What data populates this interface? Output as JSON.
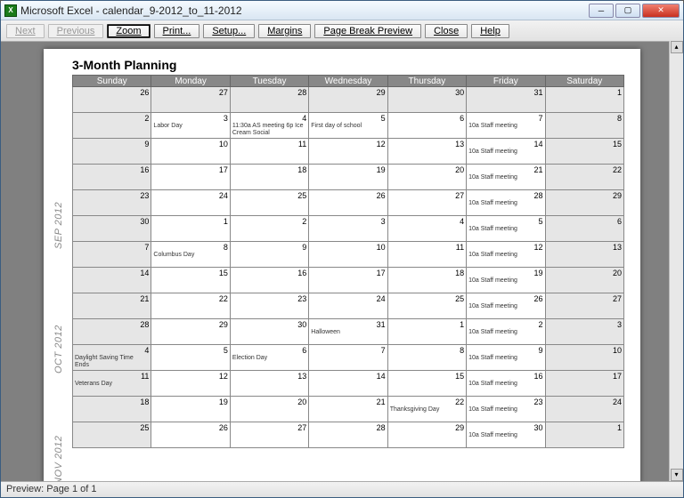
{
  "window": {
    "title": "Microsoft Excel - calendar_9-2012_to_11-2012"
  },
  "toolbar": {
    "next": "Next",
    "previous": "Previous",
    "zoom": "Zoom",
    "print": "Print...",
    "setup": "Setup...",
    "margins": "Margins",
    "page_break_preview": "Page Break Preview",
    "close": "Close",
    "help": "Help"
  },
  "status": {
    "text": "Preview: Page 1 of 1"
  },
  "calendar": {
    "title": "3-Month Planning",
    "day_headers": [
      "Sunday",
      "Monday",
      "Tuesday",
      "Wednesday",
      "Thursday",
      "Friday",
      "Saturday"
    ],
    "months": [
      {
        "label": "SEP 2012"
      },
      {
        "label": "OCT 2012"
      },
      {
        "label": "NOV 2012"
      }
    ],
    "rows": [
      [
        {
          "d": "26",
          "g": 1
        },
        {
          "d": "27",
          "g": 1
        },
        {
          "d": "28",
          "g": 1
        },
        {
          "d": "29",
          "g": 1
        },
        {
          "d": "30",
          "g": 1
        },
        {
          "d": "31",
          "g": 1
        },
        {
          "d": "1",
          "g": 1
        }
      ],
      [
        {
          "d": "2",
          "g": 1
        },
        {
          "d": "3",
          "ev": "Labor Day"
        },
        {
          "d": "4",
          "ev": "11:30a AS meeting\n6p Ice Cream Social"
        },
        {
          "d": "5",
          "ev": "First day of school"
        },
        {
          "d": "6"
        },
        {
          "d": "7",
          "ev": "10a Staff meeting"
        },
        {
          "d": "8",
          "g": 1
        }
      ],
      [
        {
          "d": "9",
          "g": 1
        },
        {
          "d": "10"
        },
        {
          "d": "11"
        },
        {
          "d": "12"
        },
        {
          "d": "13"
        },
        {
          "d": "14",
          "ev": "10a Staff meeting"
        },
        {
          "d": "15",
          "g": 1
        }
      ],
      [
        {
          "d": "16",
          "g": 1
        },
        {
          "d": "17"
        },
        {
          "d": "18"
        },
        {
          "d": "19"
        },
        {
          "d": "20"
        },
        {
          "d": "21",
          "ev": "10a Staff meeting"
        },
        {
          "d": "22",
          "g": 1
        }
      ],
      [
        {
          "d": "23",
          "g": 1
        },
        {
          "d": "24"
        },
        {
          "d": "25"
        },
        {
          "d": "26"
        },
        {
          "d": "27"
        },
        {
          "d": "28",
          "ev": "10a Staff meeting"
        },
        {
          "d": "29",
          "g": 1
        }
      ],
      [
        {
          "d": "30",
          "g": 1
        },
        {
          "d": "1"
        },
        {
          "d": "2"
        },
        {
          "d": "3"
        },
        {
          "d": "4"
        },
        {
          "d": "5",
          "ev": "10a Staff meeting"
        },
        {
          "d": "6",
          "g": 1
        }
      ],
      [
        {
          "d": "7",
          "g": 1
        },
        {
          "d": "8",
          "ev": "Columbus Day"
        },
        {
          "d": "9"
        },
        {
          "d": "10"
        },
        {
          "d": "11"
        },
        {
          "d": "12",
          "ev": "10a Staff meeting"
        },
        {
          "d": "13",
          "g": 1
        }
      ],
      [
        {
          "d": "14",
          "g": 1
        },
        {
          "d": "15"
        },
        {
          "d": "16"
        },
        {
          "d": "17"
        },
        {
          "d": "18"
        },
        {
          "d": "19",
          "ev": "10a Staff meeting"
        },
        {
          "d": "20",
          "g": 1
        }
      ],
      [
        {
          "d": "21",
          "g": 1
        },
        {
          "d": "22"
        },
        {
          "d": "23"
        },
        {
          "d": "24"
        },
        {
          "d": "25"
        },
        {
          "d": "26",
          "ev": "10a Staff meeting"
        },
        {
          "d": "27",
          "g": 1
        }
      ],
      [
        {
          "d": "28",
          "g": 1
        },
        {
          "d": "29"
        },
        {
          "d": "30"
        },
        {
          "d": "31",
          "ev": "Halloween"
        },
        {
          "d": "1"
        },
        {
          "d": "2",
          "ev": "10a Staff meeting"
        },
        {
          "d": "3",
          "g": 1
        }
      ],
      [
        {
          "d": "4",
          "g": 1,
          "ev": "Daylight Saving Time Ends"
        },
        {
          "d": "5"
        },
        {
          "d": "6",
          "ev": "Election Day"
        },
        {
          "d": "7"
        },
        {
          "d": "8"
        },
        {
          "d": "9",
          "ev": "10a Staff meeting"
        },
        {
          "d": "10",
          "g": 1
        }
      ],
      [
        {
          "d": "11",
          "g": 1,
          "ev": "Veterans Day"
        },
        {
          "d": "12"
        },
        {
          "d": "13"
        },
        {
          "d": "14"
        },
        {
          "d": "15"
        },
        {
          "d": "16",
          "ev": "10a Staff meeting"
        },
        {
          "d": "17",
          "g": 1
        }
      ],
      [
        {
          "d": "18",
          "g": 1
        },
        {
          "d": "19"
        },
        {
          "d": "20"
        },
        {
          "d": "21"
        },
        {
          "d": "22",
          "ev": "Thanksgiving Day"
        },
        {
          "d": "23",
          "ev": "10a Staff meeting"
        },
        {
          "d": "24",
          "g": 1
        }
      ],
      [
        {
          "d": "25",
          "g": 1
        },
        {
          "d": "26"
        },
        {
          "d": "27"
        },
        {
          "d": "28"
        },
        {
          "d": "29"
        },
        {
          "d": "30",
          "ev": "10a Staff meeting"
        },
        {
          "d": "1",
          "g": 1
        }
      ]
    ]
  }
}
